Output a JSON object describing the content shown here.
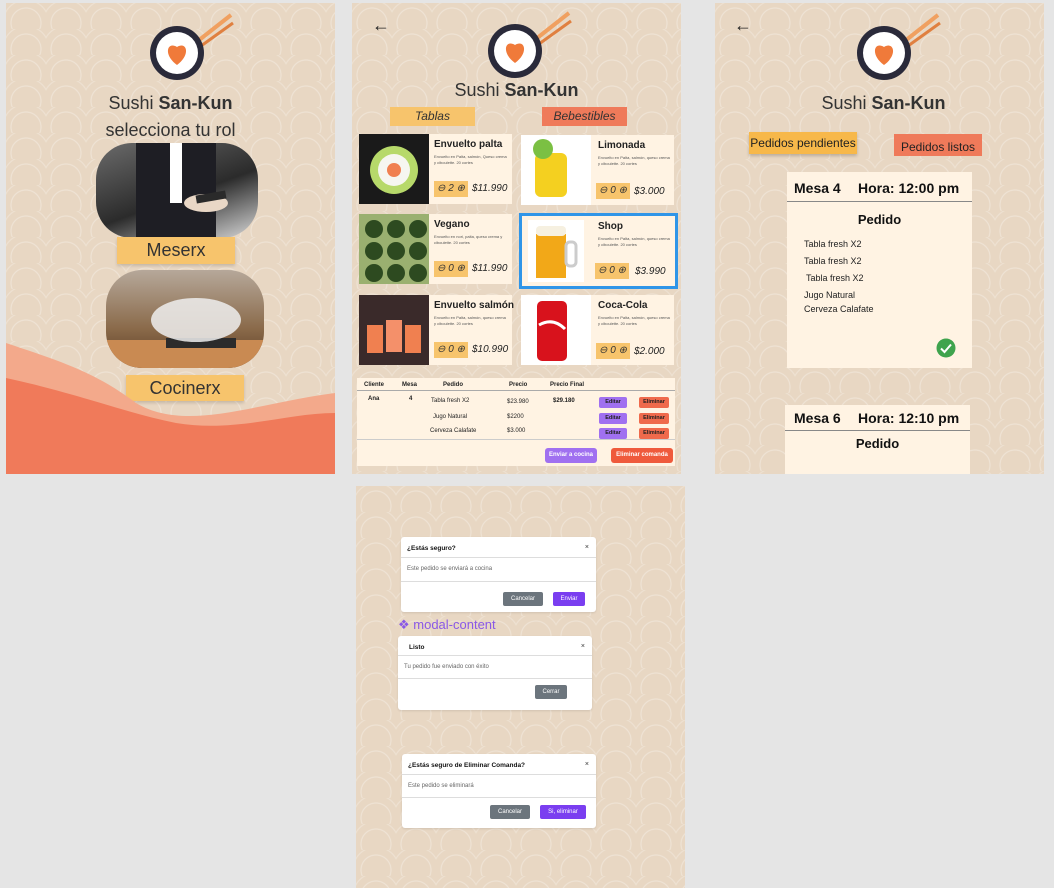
{
  "brand": {
    "prefix": "Sushi ",
    "name": "San-Kun"
  },
  "role_screen": {
    "subtitle": "selecciona tu rol",
    "waiter_label": "Meserx",
    "cook_label": "Cocinerx"
  },
  "menu_screen": {
    "back_icon": "←",
    "tabs": [
      "Tablas",
      "Bebestibles"
    ],
    "tab_colors": [
      "#f7c46c",
      "#ef7a5a"
    ],
    "left_items": [
      {
        "name": "Envuelto palta",
        "desc": "Envuelto en Palta, salmón, Queso crema y ciboulette. 20 cortes",
        "qty": "⊖ 2 ⊕",
        "price": "$11.990"
      },
      {
        "name": "Vegano",
        "desc": "Envuelto en nori, palta, queso crema y ciboulette. 20 cortes",
        "qty": "⊖ 0 ⊕",
        "price": "$11.990"
      },
      {
        "name": "Envuelto salmón",
        "desc": "Envuelto en Palta, salmón, queso crema y ciboulette. 20 cortes",
        "qty": "⊖ 0 ⊕",
        "price": "$10.990"
      }
    ],
    "right_items": [
      {
        "name": "Limonada",
        "desc": "Envuelto en Palta, salmón, queso crema y ciboulette. 20 cortes",
        "qty": "⊖ 0 ⊕",
        "price": "$3.000"
      },
      {
        "name": "Shop",
        "desc": "Envuelto en Palta, salmón, queso crema y ciboulette. 20 cortes",
        "qty": "⊖ 0 ⊕",
        "price": "$3.990"
      },
      {
        "name": "Coca-Cola",
        "desc": "Envuelto en Palta, salmón, queso crema y ciboulette. 20 cortes",
        "qty": "⊖ 0 ⊕",
        "price": "$2.000"
      }
    ],
    "table_headers": [
      "Cliente",
      "Mesa",
      "Pedido",
      "Precio",
      "Precio Final"
    ],
    "table_client": "Ana",
    "table_mesa": "4",
    "table_rows": [
      {
        "pedido": "Tabla fresh  X2",
        "precio": "$23.980"
      },
      {
        "pedido": "Jugo Natural",
        "precio": "$2200"
      },
      {
        "pedido": "Cerveza Calafate",
        "precio": "$3.000"
      }
    ],
    "table_final": "$29.180",
    "edit_label": "Editar",
    "delete_label": "Eliminar",
    "send_label": "Enviar a cocina",
    "delete_order_label": "Eliminar comanda"
  },
  "kitchen_screen": {
    "back_icon": "←",
    "tab_pending": "Pedidos pendientes",
    "tab_ready": "Pedidos listos",
    "order1": {
      "mesa": "Mesa 4",
      "hora": "Hora: 12:00 pm",
      "title": "Pedido",
      "items": [
        "Tabla fresh  X2",
        "Tabla fresh  X2",
        "Tabla fresh  X2",
        "Jugo Natural",
        "Cerveza Calafate"
      ]
    },
    "order2": {
      "mesa": "Mesa  6",
      "hora": "Hora: 12:10 pm",
      "title": "Pedido"
    }
  },
  "modals": {
    "component_label": "❖ modal-content",
    "confirm_send": {
      "title": "¿Estás seguro?",
      "body": "Este pedido se enviará a cocina",
      "cancel": "Cancelar",
      "ok": "Enviar"
    },
    "done": {
      "title": "Listo",
      "body": "Tu pedido fue enviado con éxito",
      "ok": "Cerrar"
    },
    "confirm_delete": {
      "title": "¿Estás seguro  de Eliminar Comanda?",
      "body": "Este pedido se eliminará",
      "cancel": "Cancelar",
      "ok": "Si, eliminar"
    },
    "close_icon": "×"
  }
}
